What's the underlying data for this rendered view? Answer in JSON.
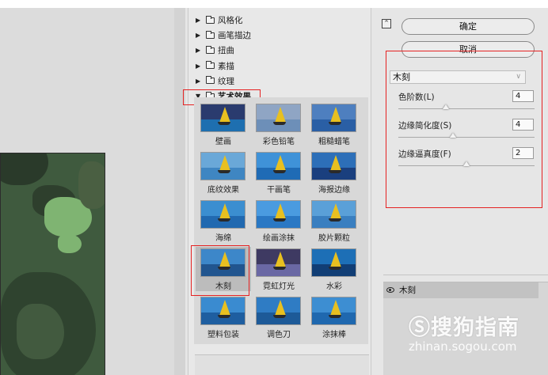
{
  "categories": [
    {
      "label": "风格化",
      "expanded": false
    },
    {
      "label": "画笔描边",
      "expanded": false
    },
    {
      "label": "扭曲",
      "expanded": false
    },
    {
      "label": "素描",
      "expanded": false
    },
    {
      "label": "纹理",
      "expanded": false
    },
    {
      "label": "艺术效果",
      "expanded": true
    }
  ],
  "filters": [
    {
      "label": "壁画",
      "variant": "mural"
    },
    {
      "label": "彩色铅笔",
      "variant": "pencil"
    },
    {
      "label": "粗糙蜡笔",
      "variant": "crayon"
    },
    {
      "label": "底纹效果",
      "variant": "underpaint"
    },
    {
      "label": "干画笔",
      "variant": "drybrush"
    },
    {
      "label": "海报边缘",
      "variant": "poster"
    },
    {
      "label": "海绵",
      "variant": "sponge"
    },
    {
      "label": "绘画涂抹",
      "variant": "smudge"
    },
    {
      "label": "胶片颗粒",
      "variant": "grain"
    },
    {
      "label": "木刻",
      "variant": "cutout",
      "selected": true
    },
    {
      "label": "霓虹灯光",
      "variant": "neon"
    },
    {
      "label": "水彩",
      "variant": "watercolor"
    },
    {
      "label": "塑料包装",
      "variant": "plastic"
    },
    {
      "label": "调色刀",
      "variant": "knife"
    },
    {
      "label": "涂抹棒",
      "variant": "stick"
    }
  ],
  "buttons": {
    "ok": "确定",
    "cancel": "取消"
  },
  "settings": {
    "filter_select": "木刻",
    "params": [
      {
        "label": "色阶数(L)",
        "value": "4",
        "level": 0.35
      },
      {
        "label": "边缘简化度(S)",
        "value": "4",
        "level": 0.4
      },
      {
        "label": "边缘逼真度(F)",
        "value": "2",
        "level": 0.5
      }
    ]
  },
  "layers": {
    "effect_name": "木刻"
  },
  "watermark": {
    "logo": "Ⓢ搜狗指南",
    "url": "zhinan.sogou.com"
  },
  "colors": {
    "highlight_red": "#e52222",
    "selected_thumb": "#bcbcbc"
  }
}
